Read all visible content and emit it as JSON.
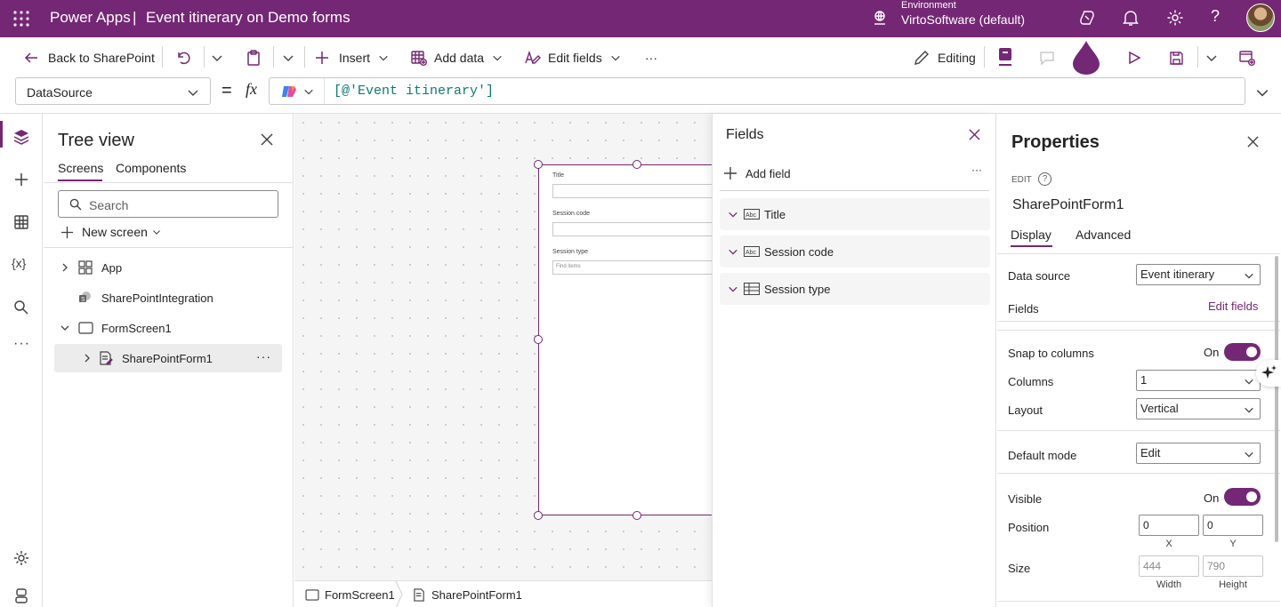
{
  "topbar": {
    "app_name": "Power Apps",
    "separator": "|",
    "doc_title": "Event itinerary on Demo forms",
    "env_label": "Environment",
    "env_name": "VirtoSoftware (default)"
  },
  "toolbar": {
    "back": "Back to SharePoint",
    "insert": "Insert",
    "add_data": "Add data",
    "edit_fields": "Edit fields",
    "more": "···",
    "editing": "Editing"
  },
  "formula": {
    "property": "DataSource",
    "equals": "=",
    "fx": "fx",
    "expression": "[@'Event itinerary']"
  },
  "tree": {
    "title": "Tree view",
    "tabs": [
      "Screens",
      "Components"
    ],
    "search_placeholder": "Search",
    "new_screen": "New screen",
    "items": [
      "App",
      "SharePointIntegration",
      "FormScreen1",
      "SharePointForm1"
    ]
  },
  "form_preview": {
    "fields": [
      "Title",
      "Session code",
      "Session type"
    ],
    "combo_placeholder": "Find items"
  },
  "breadcrumb": [
    "FormScreen1",
    "SharePointForm1"
  ],
  "fields_panel": {
    "title": "Fields",
    "add_field": "Add field",
    "more": "···",
    "items": [
      "Title",
      "Session code",
      "Session type"
    ]
  },
  "properties": {
    "title": "Properties",
    "mode": "EDIT",
    "control_name": "SharePointForm1",
    "tabs": [
      "Display",
      "Advanced"
    ],
    "data_source_label": "Data source",
    "data_source_value": "Event itinerary",
    "fields_label": "Fields",
    "edit_fields_link": "Edit fields",
    "snap_label": "Snap to columns",
    "snap_value": "On",
    "columns_label": "Columns",
    "columns_value": "1",
    "layout_label": "Layout",
    "layout_value": "Vertical",
    "default_mode_label": "Default mode",
    "default_mode_value": "Edit",
    "visible_label": "Visible",
    "visible_value": "On",
    "position_label": "Position",
    "pos_x": "0",
    "pos_y": "0",
    "x_label": "X",
    "y_label": "Y",
    "size_label": "Size",
    "width": "444",
    "height": "790",
    "width_label": "Width",
    "height_label": "Height"
  },
  "colors": {
    "brand": "#742774",
    "teal_code": "#0e7a6e"
  }
}
